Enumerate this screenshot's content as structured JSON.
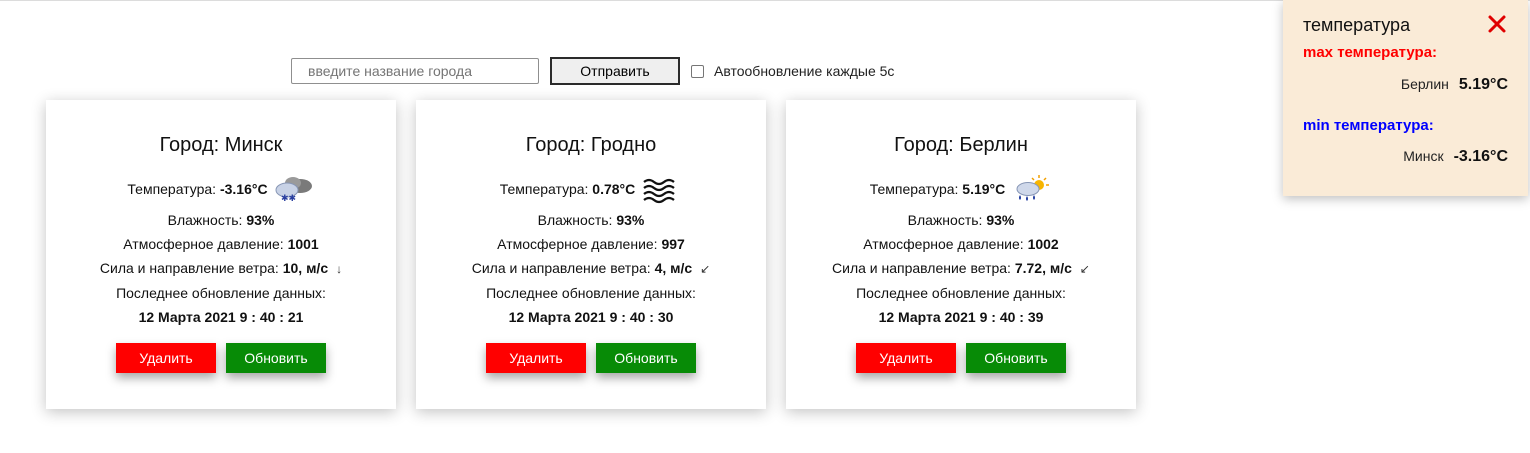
{
  "toolbar": {
    "city_placeholder": "введите название города",
    "send_label": "Отправить",
    "auto_update_label": "Автообновление каждые 5с",
    "auto_update_checked": false
  },
  "labels": {
    "city_prefix": "Город: ",
    "temperature": "Температура: ",
    "humidity": "Влажность: ",
    "pressure": "Атмосферное давление: ",
    "wind": "Сила и направление ветра: ",
    "last_update": "Последнее обновление данных:",
    "delete": "Удалить",
    "refresh": "Обновить"
  },
  "cards": [
    {
      "city": "Минск",
      "temperature": "-3.16°C",
      "weather_icon": "snow-cloud-icon",
      "humidity": "93%",
      "pressure": "1001",
      "wind": "10, м/с",
      "wind_arrow": "↓",
      "updated": "12 Марта 2021 9 : 40 : 21"
    },
    {
      "city": "Гродно",
      "temperature": "0.78°C",
      "weather_icon": "fog-icon",
      "humidity": "93%",
      "pressure": "997",
      "wind": "4, м/с",
      "wind_arrow": "↙",
      "updated": "12 Марта 2021 9 : 40 : 30"
    },
    {
      "city": "Берлин",
      "temperature": "5.19°C",
      "weather_icon": "sun-rain-cloud-icon",
      "humidity": "93%",
      "pressure": "1002",
      "wind": "7.72, м/с",
      "wind_arrow": "↙",
      "updated": "12 Марта 2021 9 : 40 : 39"
    }
  ],
  "panel": {
    "title": "температура",
    "max_label": "max температура:",
    "max_city": "Берлин",
    "max_value": "5.19°C",
    "min_label": "min температура:",
    "min_city": "Минск",
    "min_value": "-3.16°C",
    "close_icon": "close-icon"
  },
  "colors": {
    "delete": "#ff0000",
    "refresh": "#078b06",
    "panel_bg": "#faebd7",
    "max_label": "#ff0000",
    "min_label": "#0000ff",
    "close": "#e00000"
  }
}
